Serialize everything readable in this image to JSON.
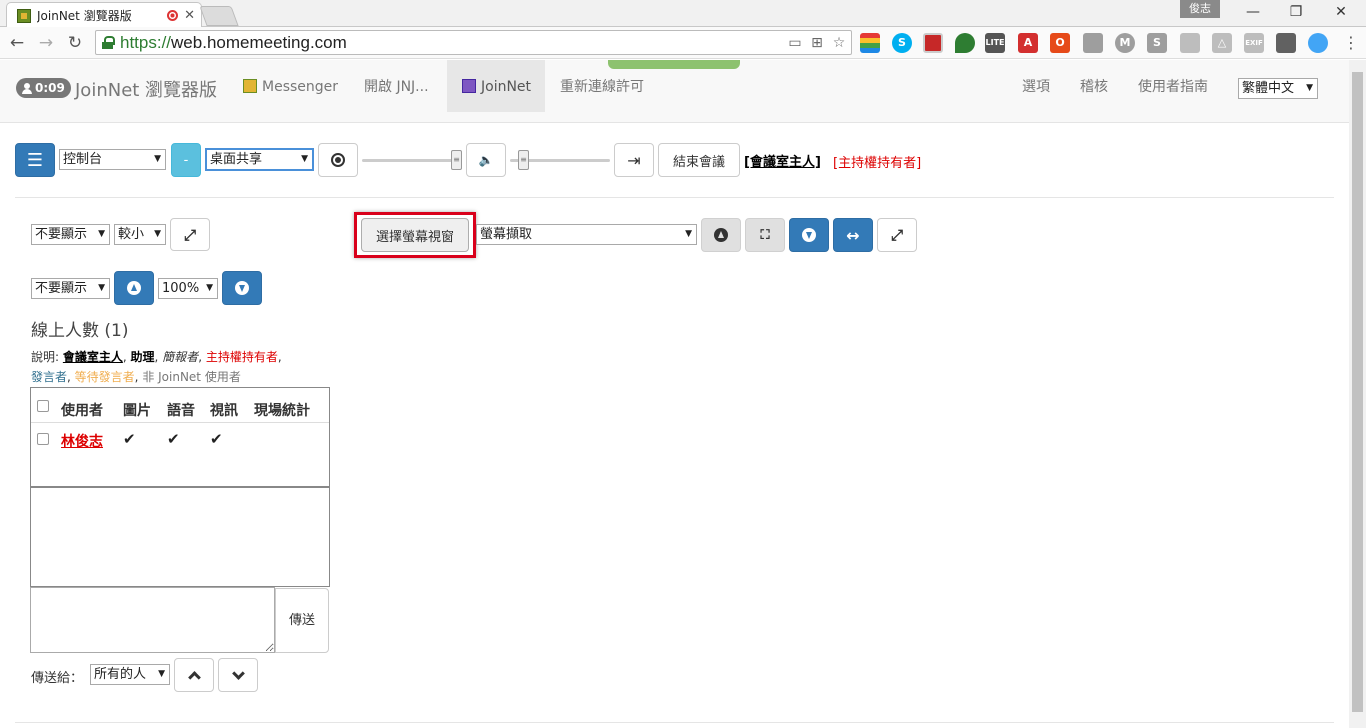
{
  "browser": {
    "tab_title": "JoinNet 瀏覽器版",
    "url_scheme": "https://",
    "url_host": "web.homemeeting.com",
    "profile_badge": "俊志",
    "extensions": [
      {
        "name": "office-icon",
        "color": "#e64a19"
      },
      {
        "name": "skype-icon",
        "color": "#00aff0"
      }
    ]
  },
  "navbar": {
    "timer": "0:09",
    "brand": "JoinNet 瀏覽器版",
    "items": [
      {
        "label": "Messenger"
      },
      {
        "label": "開啟 JNJ..."
      },
      {
        "label": "JoinNet"
      },
      {
        "label": "重新連線許可"
      }
    ],
    "right_items": [
      {
        "label": "選項"
      },
      {
        "label": "稽核"
      },
      {
        "label": "使用者指南"
      }
    ],
    "language": "繁體中文"
  },
  "controls": {
    "panel_select": "控制台",
    "minus_label": "-",
    "share_select": "桌面共享",
    "end_meeting": "結束會議",
    "role_host": "[會議室主人]",
    "role_owner": "[主持權持有者]"
  },
  "share_panel": {
    "display_select_1": "不要顯示",
    "size_select": "較小",
    "pick_window_button": "選擇螢幕視窗",
    "capture_select": "螢幕擷取",
    "display_select_2": "不要顯示",
    "zoom_select": "100%"
  },
  "participants": {
    "title": "線上人數 (1)",
    "legend_prefix": "說明: ",
    "legend_host": "會議室主人",
    "legend_assist": "助理",
    "legend_presenter": "簡報者",
    "legend_owner": "主持權持有者",
    "legend_speaker": "發言者",
    "legend_waiting": "等待發言者",
    "legend_nonjn": "非 JoinNet 使用者",
    "columns": [
      "使用者",
      "圖片",
      "語音",
      "視訊",
      "現場統計"
    ],
    "rows": [
      {
        "name": "林俊志",
        "picture": "✔",
        "audio": "✔",
        "video": "✔",
        "stats": ""
      }
    ]
  },
  "chat": {
    "send_button": "傳送",
    "send_to_label": "傳送給：",
    "send_to_select": "所有的人"
  }
}
